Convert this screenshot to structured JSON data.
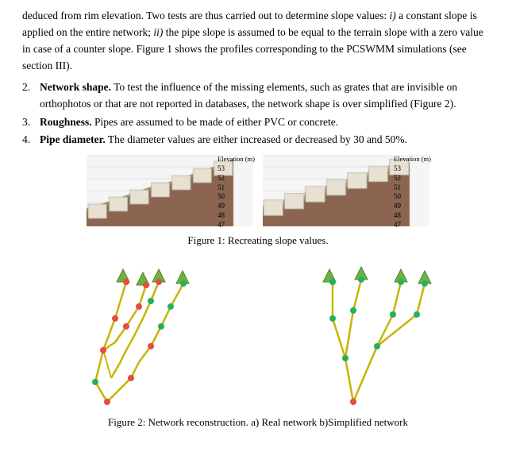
{
  "intro_text": "deduced from rim elevation. Two tests are thus carried out to determine slope values: i) a constant slope is applied on the entire network; ii) the pipe slope is assumed to be equal to the terrain slope with a zero value in case of a counter slope. Figure 1 shows the profiles corresponding to the PCSWMM simulations (see section III).",
  "list_items": [
    {
      "num": "2.",
      "bold": "Network shape.",
      "rest": " To test the influence of the missing elements, such as grates that are invisible on orthophotos or that are not reported in databases, the network shape is over simplified (Figure 2)."
    },
    {
      "num": "3.",
      "bold": "Roughness.",
      "rest": " Pipes are assumed to be made of either PVC or concrete."
    },
    {
      "num": "4.",
      "bold": "Pipe diameter.",
      "rest": " The diameter values are either increased or decreased by 30 and 50%."
    }
  ],
  "figure1_caption": "Figure 1: Recreating slope values.",
  "figure2_caption": "Figure 2: Network reconstruction. a) Real network b)Simplified network",
  "elevation_label": "Elevation (m)",
  "elevation_values": [
    53,
    52,
    51,
    50,
    49,
    48,
    47
  ],
  "accent_colors": {
    "terrain_fill": "#8B6550",
    "terrain_top": "#6B8C42",
    "structure_fill": "#D4C5B0",
    "grid_line": "#ccc"
  }
}
